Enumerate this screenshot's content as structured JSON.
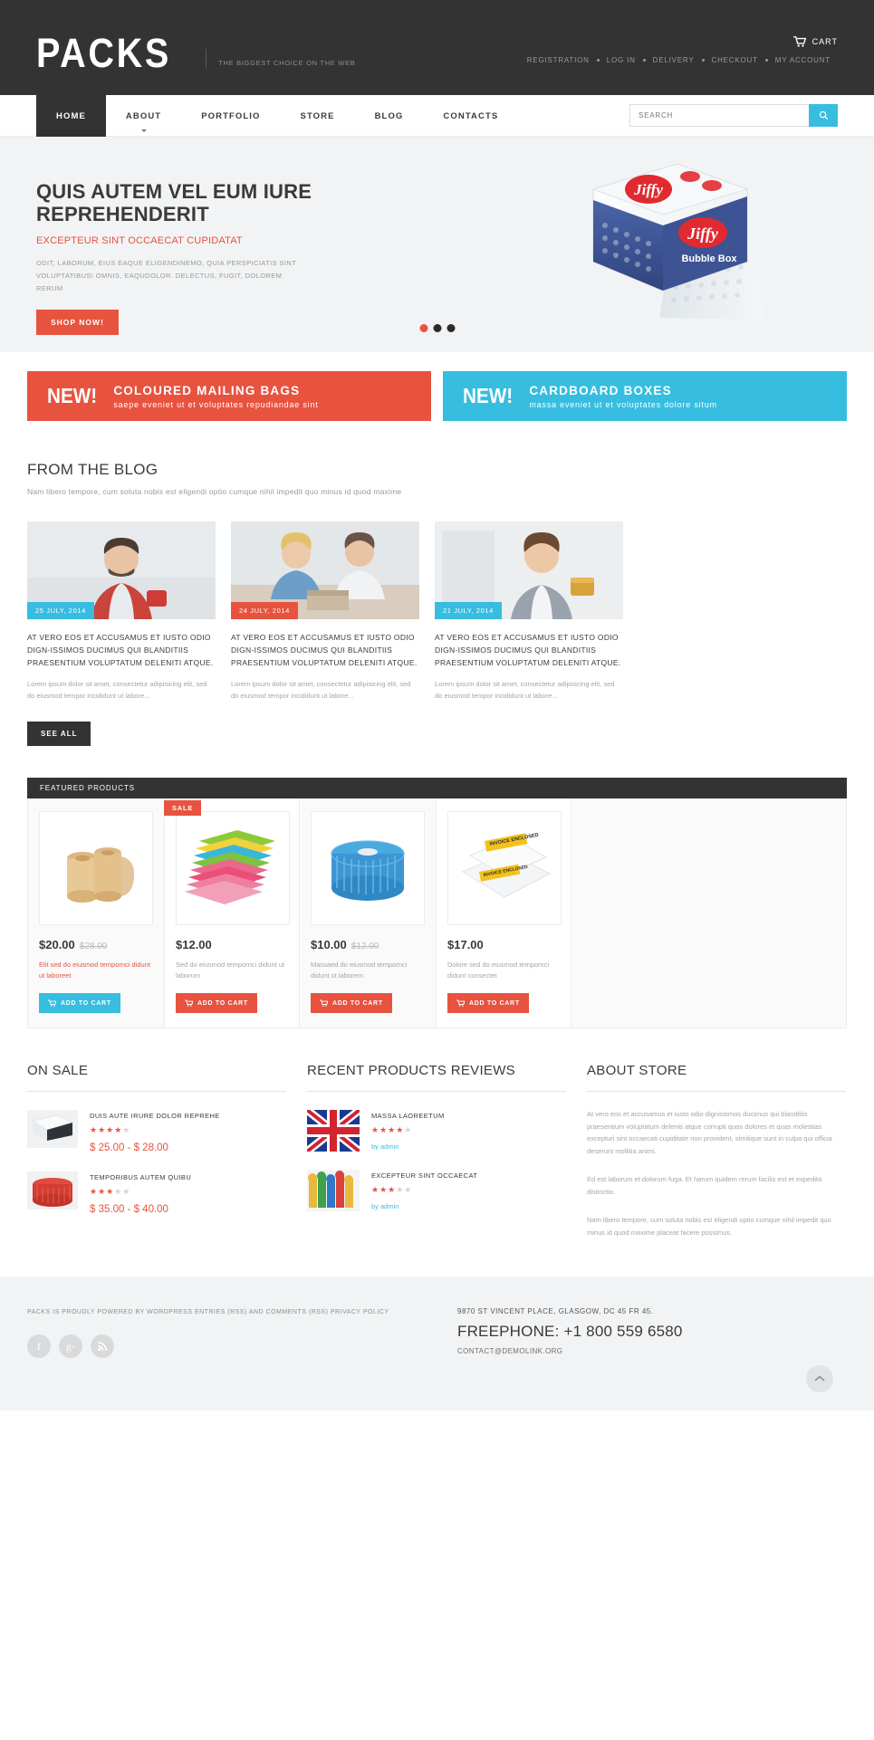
{
  "header": {
    "logo": "PACKS",
    "tagline": "THE BIGGEST CHOICE ON THE WEB",
    "cart_label": "CART",
    "cart_icon": "cart-icon",
    "top_links": [
      "REGISTRATION",
      "LOG IN",
      "DELIVERY",
      "CHECKOUT",
      "MY ACCOUNT"
    ]
  },
  "nav": {
    "items": [
      {
        "label": "HOME",
        "active": true,
        "caret": false
      },
      {
        "label": "ABOUT",
        "active": false,
        "caret": true
      },
      {
        "label": "PORTFOLIO",
        "active": false,
        "caret": false
      },
      {
        "label": "STORE",
        "active": false,
        "caret": false
      },
      {
        "label": "BLOG",
        "active": false,
        "caret": false
      },
      {
        "label": "CONTACTS",
        "active": false,
        "caret": false
      }
    ],
    "search_placeholder": "SEARCH",
    "search_value": "",
    "search_icon": "search-icon"
  },
  "hero": {
    "title": "QUIS AUTEM VEL EUM IURE REPREHENDERIT",
    "subtitle": "EXCEPTEUR SINT OCCAECAT CUPIDATAT",
    "description": "ODIT, LABORUM, EIUS EAQUE ELIGENDINEMO, QUIA PERSPICIATIS SINT VOLUPTATIBUS! OMNIS, EAQUDOLOR. DELECTUS, FUGIT, DOLOREM RERUM",
    "button": "SHOP NOW!",
    "slides": 3,
    "active_slide": 1,
    "image_alt": "Jiffy Bubble Box packaging product"
  },
  "promos": [
    {
      "new": "NEW!",
      "heading": "COLOURED MAILING BAGS",
      "sub": "saepe eveniet ut et voluptates repudiandae sint",
      "color": "#e8533f"
    },
    {
      "new": "NEW!",
      "heading": "CARDBOARD BOXES",
      "sub": "massa eveniet ut et voluptates dolore situm",
      "color": "#37bde0"
    }
  ],
  "blog": {
    "title": "FROM THE BLOG",
    "subtitle": "Nam libero tempore, cum soluta nobis est eligendi optio cumque nihil impedit quo minus id quod maxime",
    "see_all": "SEE ALL",
    "posts": [
      {
        "date": "25 JULY, 2014",
        "date_color": "#37bde0",
        "heading": "AT VERO EOS ET ACCUSAMUS ET IUSTO ODIO DIGN-ISSIMOS DUCIMUS QUI BLANDITIIS PRAESENTIUM VOLUPTATUM DELENITI ATQUE.",
        "body": "Lorem ipsum dolor sit amet, consectetur adipisicing elit, sed do eiusmod tempor incididunt ut labore..."
      },
      {
        "date": "24 JULY, 2014",
        "date_color": "#e8533f",
        "heading": "AT VERO EOS ET ACCUSAMUS ET IUSTO ODIO DIGN-ISSIMOS DUCIMUS QUI BLANDITIIS PRAESENTIUM VOLUPTATUM DELENITI ATQUE.",
        "body": "Lorem ipsum dolor sit amet, consectetur adipisicing elit, sed do eiusmod tempor incididunt ut labore..."
      },
      {
        "date": "21 JULY, 2014",
        "date_color": "#37bde0",
        "heading": "AT VERO EOS ET ACCUSAMUS ET IUSTO ODIO DIGN-ISSIMOS DUCIMUS QUI BLANDITIIS PRAESENTIUM VOLUPTATUM DELENITI ATQUE.",
        "body": "Lorem ipsum dolor sit amet, consectetur adipisicing elit, sed do eiusmod tempor incididunt ut labore..."
      }
    ]
  },
  "featured": {
    "bar_title": "FEATURED PRODUCTS",
    "products": [
      {
        "price": "$20.00",
        "old_price": "$28.00",
        "name": "Elit sed do eiusmod tempornci didunt ut laboreet",
        "name_color": "red",
        "button": "ADD TO CART",
        "button_color": "blue",
        "sale": false,
        "image_alt": "kraft corrugated paper rolls"
      },
      {
        "price": "$12.00",
        "old_price": "",
        "name": "Sed do eiusmod tempornci didunt ut laborum",
        "name_color": "gray",
        "button": "ADD TO CART",
        "button_color": "red",
        "sale": true,
        "sale_label": "SALE",
        "image_alt": "coloured mailing paper sheets"
      },
      {
        "price": "$10.00",
        "old_price": "$12.00",
        "name": "Massaed do eiusmod tempornci didunt ut laborem",
        "name_color": "gray",
        "button": "ADD TO CART",
        "button_color": "red",
        "sale": false,
        "image_alt": "blue corrugated roll"
      },
      {
        "price": "$17.00",
        "old_price": "",
        "name": "Dolore sed do eiusmod tempornci didunt consectet",
        "name_color": "gray",
        "button": "ADD TO CART",
        "button_color": "red",
        "sale": false,
        "image_alt": "invoice enclosed document pouches"
      }
    ]
  },
  "on_sale": {
    "title": "ON SALE",
    "items": [
      {
        "name": "DUIS AUTE IRURE DOLOR REPREHE",
        "rating": 4,
        "price": "$ 25.00 - $ 28.00",
        "image_alt": "white foam mailer"
      },
      {
        "name": "TEMPORIBUS AUTEM QUIBU",
        "rating": 3,
        "price": "$ 35.00 - $ 40.00",
        "image_alt": "red corrugated roll"
      }
    ]
  },
  "reviews": {
    "title": "RECENT PRODUCTS REVIEWS",
    "items": [
      {
        "name": "MASSA LAOREETUM",
        "rating": 4,
        "by": "by admin",
        "image_alt": "union jack flag gift wrap"
      },
      {
        "name": "EXCEPTEUR SINT OCCAECAT",
        "rating": 3,
        "by": "by admin",
        "image_alt": "coloured pinwheel decorations"
      }
    ]
  },
  "about": {
    "title": "ABOUT STORE",
    "paragraphs": [
      "At vero eos et accusamus et iusto odio dignissimos ducimus qui blanditiis praesentium voluptatum deleniti atque corrupti quos dolores et quas molestias excepturi sint occaecati cupiditate non provident, similique sunt in culpa qui officia deserunt mollitia animi.",
      "Ed est laborum et dolorum fuga. Et harum quidem rerum facilis est et expedita distinctio.",
      "Nam libero tempore, cum soluta nobis est eligendi optio cumque nihil impedit quo minus id quod maxime placeat facere possimus."
    ]
  },
  "footer": {
    "copyright": "PACKS IS PROUDLY POWERED BY WORDPRESS ENTRIES (RSS) AND COMMENTS (RSS) PRIVACY POLICY",
    "socials": [
      "facebook-icon",
      "google-plus-icon",
      "rss-icon"
    ],
    "address": "9870 ST VINCENT PLACE,  GLASGOW, DC 45 FR 45.",
    "phone_label": "FREEPHONE:",
    "phone": "+1 800 559 6580",
    "email": "CONTACT@DEMOLINK.ORG",
    "to_top_icon": "chevron-up-icon"
  }
}
